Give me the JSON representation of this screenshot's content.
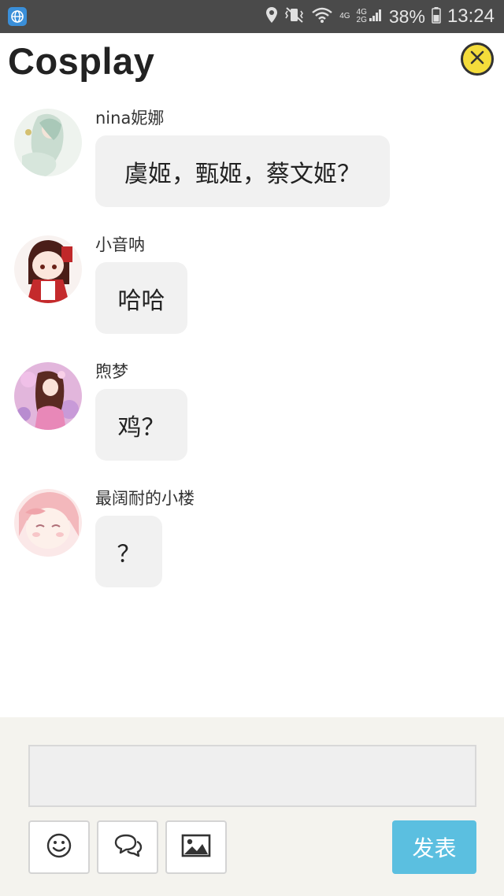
{
  "status_bar": {
    "net_top": "4G",
    "net_mid": "4G",
    "net_bottom": "2G",
    "battery": "38%",
    "time": "13:24"
  },
  "header": {
    "title": "Cosplay"
  },
  "messages": [
    {
      "name": "nina妮娜",
      "text": "虞姬，甄姬，蔡文姬？"
    },
    {
      "name": "小音呐",
      "text": "哈哈"
    },
    {
      "name": "煦梦",
      "text": "鸡？"
    },
    {
      "name": "最阔耐的小楼",
      "text": "？"
    }
  ],
  "composer": {
    "input_value": "",
    "send_label": "发表"
  },
  "icons": {
    "app": "browser-globe-icon",
    "close": "close-circle-icon",
    "emoji": "smiley-icon",
    "comment": "chat-bubbles-icon",
    "image": "image-icon"
  },
  "colors": {
    "status_bar_bg": "#4a4a4a",
    "close_button": "#f4dc3b",
    "bubble_bg": "#f1f1f1",
    "composer_bg": "#f4f3ee",
    "send_button": "#5bbfe0"
  }
}
